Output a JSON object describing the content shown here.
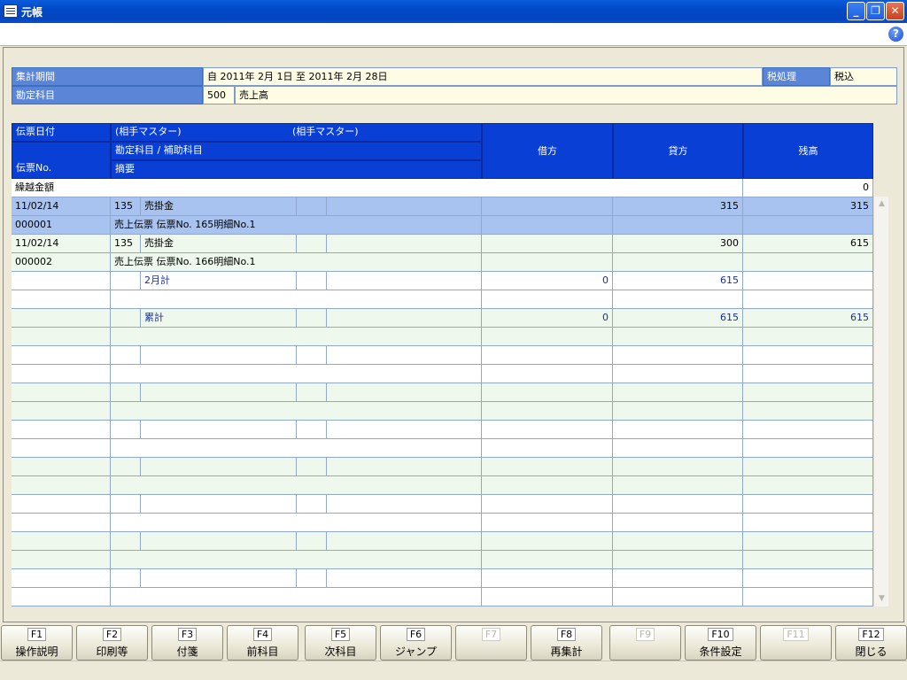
{
  "window": {
    "title": "元帳"
  },
  "info": {
    "period_label": "集計期間",
    "period_value": "自 2011年  2月  1日  至 2011年  2月 28日",
    "tax_label": "税処理",
    "tax_value": "税込",
    "account_label": "勘定科目",
    "account_code": "500",
    "account_name": "売上高"
  },
  "grid_header": {
    "date": "伝票日付",
    "partner1": "(相手マスター)",
    "partner2": "(相手マスター)",
    "account_sub": "勘定科目 / 補助科目",
    "slip_no": "伝票No.",
    "memo": "摘要",
    "debit": "借方",
    "credit": "貸方",
    "balance": "残高"
  },
  "carry_over": {
    "label": "繰越金額",
    "balance": "0"
  },
  "rows": [
    {
      "c1": "11/02/14",
      "c2": "135",
      "c3": "売掛金",
      "c4": "",
      "c5": "",
      "c6": "",
      "c7": "315",
      "c8": "315",
      "bg": "sel",
      "type": "split"
    },
    {
      "c1": "000001",
      "memo": "売上伝票 伝票No.   165明細No.1",
      "c6": "",
      "c7": "",
      "c8": "",
      "bg": "sel",
      "type": "memo"
    },
    {
      "c1": "11/02/14",
      "c2": "135",
      "c3": "売掛金",
      "c4": "",
      "c5": "",
      "c6": "",
      "c7": "300",
      "c8": "615",
      "bg": "green",
      "type": "split"
    },
    {
      "c1": "000002",
      "memo": "売上伝票 伝票No.   166明細No.1",
      "c6": "",
      "c7": "",
      "c8": "",
      "bg": "green",
      "type": "memo"
    },
    {
      "c1": "",
      "c2": "",
      "c3": "2月計",
      "c4": "",
      "c5": "",
      "c6": "0",
      "c7": "615",
      "c8": "",
      "bg": "white",
      "type": "split",
      "blue": true
    },
    {
      "c1": "",
      "memo": "",
      "c6": "",
      "c7": "",
      "c8": "",
      "bg": "white",
      "type": "memo"
    },
    {
      "c1": "",
      "c2": "",
      "c3": "累計",
      "c4": "",
      "c5": "",
      "c6": "0",
      "c7": "615",
      "c8": "615",
      "bg": "green",
      "type": "split",
      "blue": true
    },
    {
      "c1": "",
      "memo": "",
      "c6": "",
      "c7": "",
      "c8": "",
      "bg": "green",
      "type": "memo"
    },
    {
      "c1": "",
      "c2": "",
      "c3": "",
      "c4": "",
      "c5": "",
      "c6": "",
      "c7": "",
      "c8": "",
      "bg": "white",
      "type": "split"
    },
    {
      "c1": "",
      "memo": "",
      "c6": "",
      "c7": "",
      "c8": "",
      "bg": "white",
      "type": "memo"
    },
    {
      "c1": "",
      "c2": "",
      "c3": "",
      "c4": "",
      "c5": "",
      "c6": "",
      "c7": "",
      "c8": "",
      "bg": "green",
      "type": "split"
    },
    {
      "c1": "",
      "memo": "",
      "c6": "",
      "c7": "",
      "c8": "",
      "bg": "green",
      "type": "memo"
    },
    {
      "c1": "",
      "c2": "",
      "c3": "",
      "c4": "",
      "c5": "",
      "c6": "",
      "c7": "",
      "c8": "",
      "bg": "white",
      "type": "split"
    },
    {
      "c1": "",
      "memo": "",
      "c6": "",
      "c7": "",
      "c8": "",
      "bg": "white",
      "type": "memo"
    },
    {
      "c1": "",
      "c2": "",
      "c3": "",
      "c4": "",
      "c5": "",
      "c6": "",
      "c7": "",
      "c8": "",
      "bg": "green",
      "type": "split"
    },
    {
      "c1": "",
      "memo": "",
      "c6": "",
      "c7": "",
      "c8": "",
      "bg": "green",
      "type": "memo"
    },
    {
      "c1": "",
      "c2": "",
      "c3": "",
      "c4": "",
      "c5": "",
      "c6": "",
      "c7": "",
      "c8": "",
      "bg": "white",
      "type": "split"
    },
    {
      "c1": "",
      "memo": "",
      "c6": "",
      "c7": "",
      "c8": "",
      "bg": "white",
      "type": "memo"
    },
    {
      "c1": "",
      "c2": "",
      "c3": "",
      "c4": "",
      "c5": "",
      "c6": "",
      "c7": "",
      "c8": "",
      "bg": "green",
      "type": "split"
    },
    {
      "c1": "",
      "memo": "",
      "c6": "",
      "c7": "",
      "c8": "",
      "bg": "green",
      "type": "memo"
    },
    {
      "c1": "",
      "c2": "",
      "c3": "",
      "c4": "",
      "c5": "",
      "c6": "",
      "c7": "",
      "c8": "",
      "bg": "white",
      "type": "split"
    },
    {
      "c1": "",
      "memo": "",
      "c6": "",
      "c7": "",
      "c8": "",
      "bg": "white",
      "type": "memo"
    }
  ],
  "fkeys": [
    {
      "key": "F1",
      "label": "操作説明",
      "enabled": true
    },
    {
      "key": "F2",
      "label": "印刷等",
      "enabled": true
    },
    {
      "key": "F3",
      "label": "付箋",
      "enabled": true
    },
    {
      "key": "F4",
      "label": "前科目",
      "enabled": true
    },
    {
      "key": "F5",
      "label": "次科目",
      "enabled": true
    },
    {
      "key": "F6",
      "label": "ジャンプ",
      "enabled": true
    },
    {
      "key": "F7",
      "label": "",
      "enabled": false
    },
    {
      "key": "F8",
      "label": "再集計",
      "enabled": true
    },
    {
      "key": "F9",
      "label": "",
      "enabled": false
    },
    {
      "key": "F10",
      "label": "条件設定",
      "enabled": true
    },
    {
      "key": "F11",
      "label": "",
      "enabled": false
    },
    {
      "key": "F12",
      "label": "閉じる",
      "enabled": true
    }
  ]
}
